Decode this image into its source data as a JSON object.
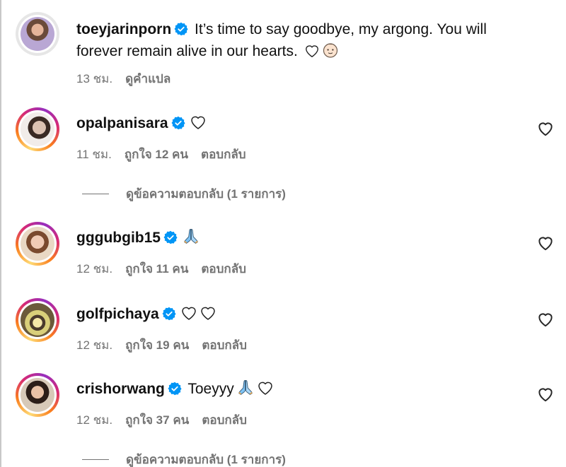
{
  "caption": {
    "username": "toeyjarinporn",
    "text_line1": "It’s time to say goodbye, my argong. You will",
    "text_line2": "forever remain alive in our hearts.",
    "time": "13 ชม.",
    "translate": "ดูคำแปล"
  },
  "comments": [
    {
      "username": "opalpanisara",
      "text": "",
      "time": "11 ชม.",
      "likes": "ถูกใจ 12 คน",
      "reply": "ตอบกลับ",
      "view_replies": "ดูข้อความตอบกลับ (1 รายการ)"
    },
    {
      "username": "gggubgib15",
      "text": "",
      "time": "12 ชม.",
      "likes": "ถูกใจ 11 คน",
      "reply": "ตอบกลับ"
    },
    {
      "username": "golfpichaya",
      "text": "",
      "time": "12 ชม.",
      "likes": "ถูกใจ 19 คน",
      "reply": "ตอบกลับ"
    },
    {
      "username": "crishorwang",
      "text": "Toeyyy",
      "time": "12 ชม.",
      "likes": "ถูกใจ 37 คน",
      "reply": "ตอบกลับ",
      "view_replies": "ดูข้อความตอบกลับ (1 รายการ)"
    }
  ],
  "colors": {
    "verified": "#0095f6",
    "meta_text": "#737373"
  },
  "icons": [
    "verified-badge-icon",
    "white-heart-icon",
    "baby-face-icon",
    "folded-hands-icon",
    "heart-outline-icon"
  ]
}
